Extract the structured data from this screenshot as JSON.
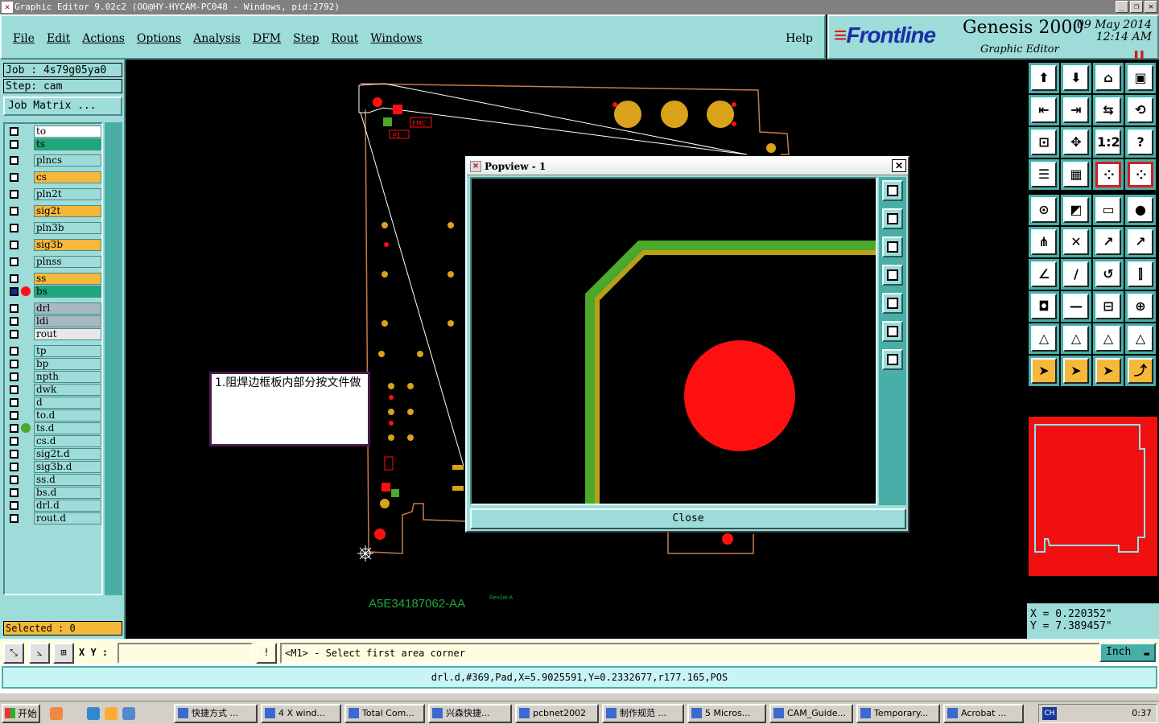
{
  "window": {
    "title": "Graphic Editor 9.02c2 (OO@HY-HYCAM-PC048 - Windows, pid:2792)"
  },
  "menu": {
    "items": [
      "File",
      "Edit",
      "Actions",
      "Options",
      "Analysis",
      "DFM",
      "Step",
      "Rout",
      "Windows"
    ],
    "help": "Help"
  },
  "brand": {
    "logo": "Frontline",
    "product": "Genesis 2000",
    "subtitle": "Graphic Editor",
    "date": "09 May 2014",
    "time": "12:14 AM"
  },
  "job": {
    "job_label": "Job : 4s79g05ya0",
    "step_label": "Step: cam",
    "matrix_button": "Job Matrix ..."
  },
  "layers": [
    {
      "name": "to",
      "color": "#ffffff"
    },
    {
      "name": "ts",
      "color": "#1fa87a"
    },
    {
      "name": "plncs",
      "color": "#9ddcd8"
    },
    {
      "name": "cs",
      "color": "#f5b83a"
    },
    {
      "name": "pln2t",
      "color": "#9ddcd8"
    },
    {
      "name": "sig2t",
      "color": "#f5b83a"
    },
    {
      "name": "pln3b",
      "color": "#9ddcd8"
    },
    {
      "name": "sig3b",
      "color": "#f5b83a"
    },
    {
      "name": "plnss",
      "color": "#9ddcd8"
    },
    {
      "name": "ss",
      "color": "#f5b83a"
    },
    {
      "name": "bs",
      "color": "#1fa87a",
      "active": true
    },
    {
      "name": "drl",
      "color": "#a8b8c0"
    },
    {
      "name": "ldi",
      "color": "#a8b8c0"
    },
    {
      "name": "rout",
      "color": "#e8e8e8"
    },
    {
      "name": "tp",
      "color": "#9ddcd8"
    },
    {
      "name": "bp",
      "color": "#9ddcd8"
    },
    {
      "name": "npth",
      "color": "#9ddcd8"
    },
    {
      "name": "dwk",
      "color": "#9ddcd8"
    },
    {
      "name": "d",
      "color": "#9ddcd8"
    },
    {
      "name": "to.d",
      "color": "#9ddcd8"
    },
    {
      "name": "ts.d",
      "color": "#9ddcd8",
      "dot": "#4aa82a"
    },
    {
      "name": "cs.d",
      "color": "#9ddcd8"
    },
    {
      "name": "sig2t.d",
      "color": "#9ddcd8"
    },
    {
      "name": "sig3b.d",
      "color": "#9ddcd8"
    },
    {
      "name": "ss.d",
      "color": "#9ddcd8"
    },
    {
      "name": "bs.d",
      "color": "#9ddcd8"
    },
    {
      "name": "drl.d",
      "color": "#9ddcd8"
    },
    {
      "name": "rout.d",
      "color": "#9ddcd8"
    }
  ],
  "selected": "Selected : 0",
  "canvas": {
    "part_number": "A5E34187062-AA",
    "revision": "Rev1ot-A",
    "note": "1.阻焊边框板内部分按文件做",
    "board_text_1": "EMC",
    "board_text_2": "P1"
  },
  "popview": {
    "title": "Popview - 1",
    "close_label": "Close"
  },
  "coords": {
    "x": "X = 0.220352\"",
    "y": "Y = 7.389457\""
  },
  "cmd": {
    "xy_label": "X Y :",
    "xy_value": "",
    "prompt": "<M1> - Select first area corner",
    "unit": "Inch"
  },
  "status": "drl.d,#369,Pad,X=5.9025591,Y=0.2332677,r177.165,POS",
  "taskbar": {
    "start": "开始",
    "tasks": [
      "快捷方式 ...",
      "4 X wind...",
      "Total Com...",
      "兴森快捷...",
      "pcbnet2002",
      "制作规范 ...",
      "5 Micros...",
      "CAM_Guide...",
      "Temporary...",
      "Acrobat ..."
    ],
    "lang": "CH",
    "clock": "0:37"
  },
  "colors": {
    "panel": "#9ddcd8",
    "panel_dark": "#4aaea8",
    "copper": "#d9a21a",
    "pad_red": "#ff1010",
    "trace_green": "#4aa82a",
    "outline": "#c87a4a"
  }
}
